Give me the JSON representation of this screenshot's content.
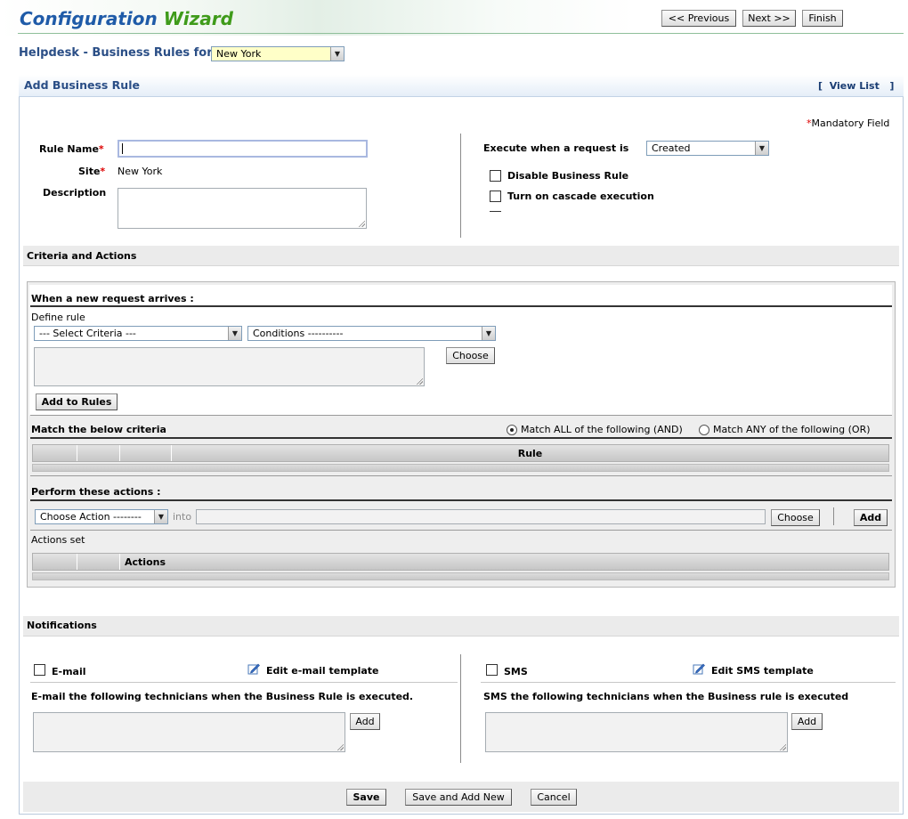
{
  "wizard": {
    "title_main": "Configuration",
    "title_accent": "Wizard",
    "previous_label": "<< Previous",
    "next_label": "Next >>",
    "finish_label": "Finish"
  },
  "helpdesk": {
    "label": "Helpdesk - Business Rules for",
    "site_selected": "New York"
  },
  "section": {
    "title": "Add Business Rule",
    "view_list_open": "[",
    "view_list_label": "View List",
    "view_list_close": "]"
  },
  "form": {
    "mandatory_star": "*",
    "mandatory_label": "Mandatory Field",
    "rule_name_label": "Rule Name",
    "rule_name_value": "",
    "site_label": "Site",
    "site_value": "New York",
    "description_label": "Description",
    "description_value": "",
    "required_star": "*",
    "execute_label": "Execute when a request is",
    "execute_selected": "Created",
    "disable_label": "Disable Business Rule",
    "cascade_label": "Turn on cascade execution"
  },
  "criteria": {
    "section_title": "Criteria and Actions",
    "new_request_title": "When a new request arrives :",
    "define_rule_label": "Define rule",
    "criteria_selected": "--- Select Criteria ---",
    "conditions_selected": "Conditions ----------",
    "choose_label": "Choose",
    "add_to_rules_label": "Add to Rules",
    "match_title": "Match the below criteria",
    "match_all_label": "Match ALL of the following (AND)",
    "match_any_label": "Match ANY of the following (OR)",
    "rules_table_header": "Rule",
    "actions_title": "Perform these actions :",
    "action_selected": "Choose Action --------",
    "into_label": "into",
    "action_choose_label": "Choose",
    "add_label": "Add",
    "actions_set_label": "Actions set",
    "actions_table_header": "Actions"
  },
  "notifications": {
    "section_title": "Notifications",
    "email_label": "E-mail",
    "edit_email_label": "Edit e-mail template",
    "email_desc": "E-mail the following technicians when the Business Rule is executed.",
    "email_add_label": "Add",
    "sms_label": "SMS",
    "edit_sms_label": "Edit SMS template",
    "sms_desc": "SMS the following technicians when the Business rule is executed",
    "sms_add_label": "Add"
  },
  "footer": {
    "save_label": "Save",
    "save_add_new_label": "Save and Add New",
    "cancel_label": "Cancel"
  },
  "colors": {
    "title_blue": "#1f5ba8",
    "title_green": "#3f9b1a",
    "heading_blue": "#2a4e86",
    "required_red": "#dd0000"
  }
}
